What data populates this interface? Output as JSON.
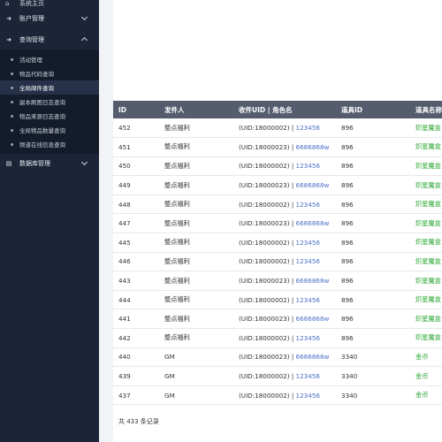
{
  "sidebar": {
    "home_label": "系统主页",
    "groups": [
      {
        "label": "账户管理",
        "icon": "sign-in-icon"
      },
      {
        "label": "查询管理",
        "icon": "sign-in-icon"
      },
      {
        "label": "数据库管理",
        "icon": "database-icon"
      }
    ],
    "query_items": [
      {
        "label": "活动管理"
      },
      {
        "label": "物品代码查询"
      },
      {
        "label": "全局邮件查询"
      },
      {
        "label": "副本刷图日志查询"
      },
      {
        "label": "物品来源日志查询"
      },
      {
        "label": "全局物品数量查询"
      },
      {
        "label": "频道在线信息查询"
      }
    ]
  },
  "table": {
    "headers": {
      "id": "ID",
      "sender": "发件人",
      "uid_role": "收件UID | 角色名",
      "item_id": "道具ID",
      "item_name": "道具名称"
    },
    "rows": [
      {
        "id": "452",
        "sender": "整点福利",
        "uid": "(UID:18000002) | ",
        "role": "123456",
        "item_id": "896",
        "item_name": "炽星魔盒"
      },
      {
        "id": "451",
        "sender": "整点福利",
        "uid": "(UID:18000023) | ",
        "role": "6686868w",
        "item_id": "896",
        "item_name": "炽星魔盒"
      },
      {
        "id": "450",
        "sender": "整点福利",
        "uid": "(UID:18000002) | ",
        "role": "123456",
        "item_id": "896",
        "item_name": "炽星魔盒"
      },
      {
        "id": "449",
        "sender": "整点福利",
        "uid": "(UID:18000023) | ",
        "role": "6686868w",
        "item_id": "896",
        "item_name": "炽星魔盒"
      },
      {
        "id": "448",
        "sender": "整点福利",
        "uid": "(UID:18000002) | ",
        "role": "123456",
        "item_id": "896",
        "item_name": "炽星魔盒"
      },
      {
        "id": "447",
        "sender": "整点福利",
        "uid": "(UID:18000023) | ",
        "role": "6686868w",
        "item_id": "896",
        "item_name": "炽星魔盒"
      },
      {
        "id": "445",
        "sender": "整点福利",
        "uid": "(UID:18000002) | ",
        "role": "123456",
        "item_id": "896",
        "item_name": "炽星魔盒"
      },
      {
        "id": "446",
        "sender": "整点福利",
        "uid": "(UID:18000002) | ",
        "role": "123456",
        "item_id": "896",
        "item_name": "炽星魔盒"
      },
      {
        "id": "443",
        "sender": "整点福利",
        "uid": "(UID:18000023) | ",
        "role": "6686868w",
        "item_id": "896",
        "item_name": "炽星魔盒"
      },
      {
        "id": "444",
        "sender": "整点福利",
        "uid": "(UID:18000002) | ",
        "role": "123456",
        "item_id": "896",
        "item_name": "炽星魔盒"
      },
      {
        "id": "441",
        "sender": "整点福利",
        "uid": "(UID:18000023) | ",
        "role": "6686868w",
        "item_id": "896",
        "item_name": "炽星魔盒"
      },
      {
        "id": "442",
        "sender": "整点福利",
        "uid": "(UID:18000002) | ",
        "role": "123456",
        "item_id": "896",
        "item_name": "炽星魔盒"
      },
      {
        "id": "440",
        "sender": "GM",
        "uid": "(UID:18000023) | ",
        "role": "6686868w",
        "item_id": "3340",
        "item_name": "金币"
      },
      {
        "id": "439",
        "sender": "GM",
        "uid": "(UID:18000002) | ",
        "role": "123456",
        "item_id": "3340",
        "item_name": "金币"
      },
      {
        "id": "437",
        "sender": "GM",
        "uid": "(UID:18000002) | ",
        "role": "123456",
        "item_id": "3340",
        "item_name": "金币"
      }
    ],
    "footer": "共 433 条记录"
  }
}
